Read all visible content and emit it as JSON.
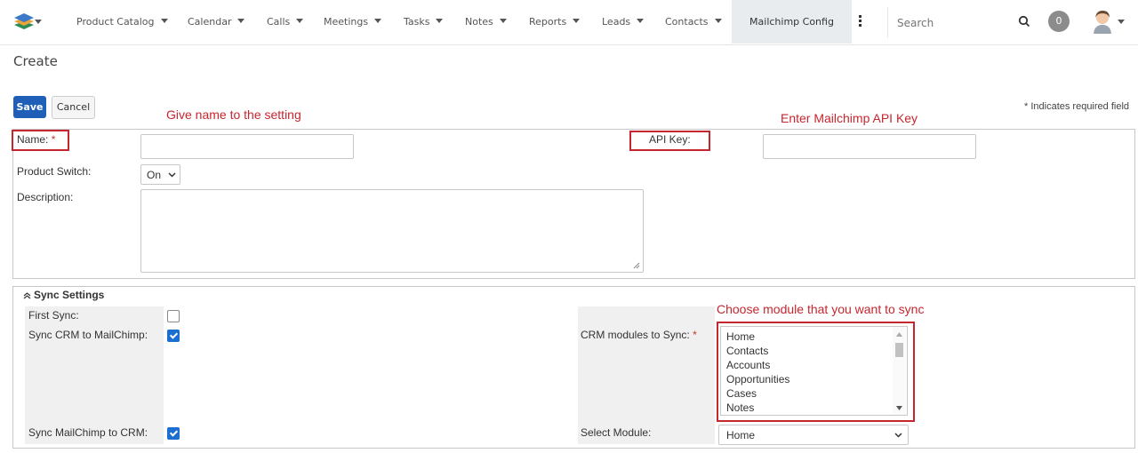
{
  "nav": {
    "items": [
      "Product Catalog",
      "Calendar",
      "Calls",
      "Meetings",
      "Tasks",
      "Notes",
      "Reports",
      "Leads",
      "Contacts"
    ],
    "active_item": "Mailchimp Config",
    "search_placeholder": "Search",
    "notification_count": "0"
  },
  "page": {
    "title": "Create"
  },
  "actions": {
    "save": "Save",
    "cancel": "Cancel",
    "required_note": "* Indicates required field"
  },
  "annotations": {
    "name_hint": "Give name to the setting",
    "api_hint": "Enter Mailchimp API Key",
    "module_hint": "Choose module that you want  to sync"
  },
  "form": {
    "name_label": "Name:",
    "required_star": "*",
    "api_key_label": "API Key:",
    "product_switch_label": "Product Switch:",
    "product_switch_value": "On",
    "description_label": "Description:"
  },
  "sync": {
    "header": "Sync Settings",
    "first_sync_label": "First Sync:",
    "first_sync_checked": false,
    "crm_to_mailchimp_label": "Sync CRM to MailChimp:",
    "crm_to_mailchimp_checked": true,
    "mailchimp_to_crm_label": "Sync MailChimp to CRM:",
    "mailchimp_to_crm_checked": true,
    "crm_modules_label": "CRM modules to Sync:",
    "crm_modules": [
      "Home",
      "Contacts",
      "Accounts",
      "Opportunities",
      "Cases",
      "Notes"
    ],
    "select_module_label": "Select Module:",
    "select_module_value": "Home"
  }
}
